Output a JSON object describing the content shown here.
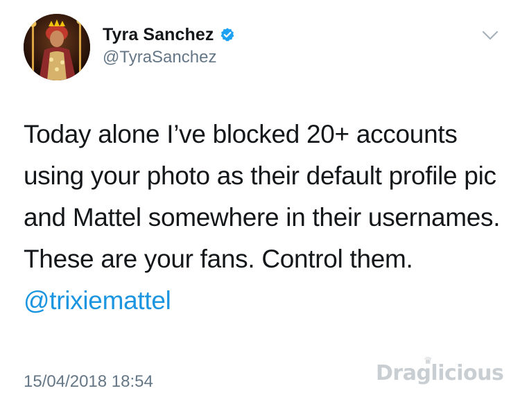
{
  "author": {
    "display_name": "Tyra Sanchez",
    "handle": "@TyraSanchez",
    "verified": true
  },
  "tweet": {
    "text_before_mention": "Today alone I’ve blocked 20+ accounts using your photo as their default profile pic and Mattel somewhere in their usernames. These are your fans. Control them. ",
    "mention": "@trixiemattel",
    "timestamp": "15/04/2018 18:54"
  },
  "watermark": {
    "text": "Draglicious"
  },
  "icons": {
    "verified": "verified-badge-icon",
    "menu": "chevron-down-icon"
  },
  "colors": {
    "text": "#14171a",
    "secondary": "#657786",
    "link": "#1b95e0",
    "verified": "#1da1f2",
    "watermark": "#c9ced2"
  }
}
